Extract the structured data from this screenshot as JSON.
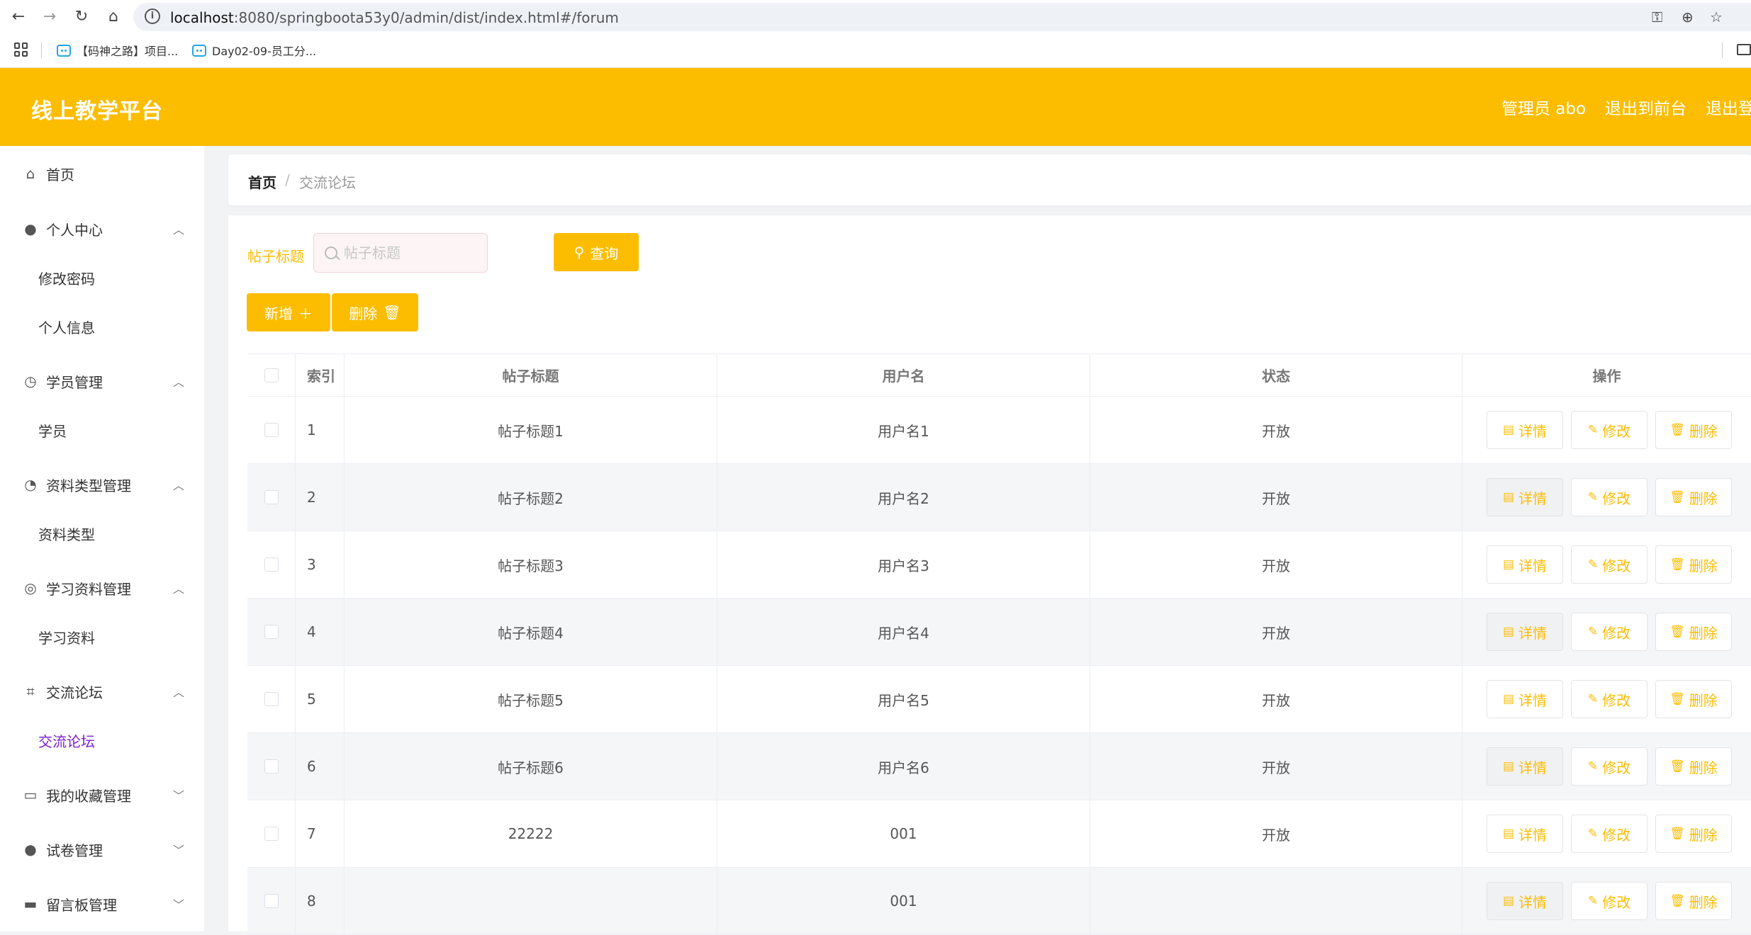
{
  "browser": {
    "url_host": "localhost",
    "url_rest": ":8080/springboota53y0/admin/dist/index.html#/forum",
    "bookmarks": [
      "【码神之路】项目...",
      "Day02-09-员工分..."
    ]
  },
  "header": {
    "title": "线上教学平台",
    "user": "管理员 abo",
    "to_front": "退出到前台",
    "logout": "退出登"
  },
  "sidebar": {
    "home": "首页",
    "personal": "个人中心",
    "change_password": "修改密码",
    "personal_info": "个人信息",
    "student_mgmt": "学员管理",
    "student": "学员",
    "material_type_mgmt": "资料类型管理",
    "material_type": "资料类型",
    "material_mgmt": "学习资料管理",
    "material": "学习资料",
    "forum_group": "交流论坛",
    "forum": "交流论坛",
    "favorites": "我的收藏管理",
    "exam": "试卷管理",
    "board": "留言板管理"
  },
  "breadcrumb": {
    "home": "首页",
    "sep": "/",
    "current": "交流论坛"
  },
  "search": {
    "label": "帖子标题",
    "placeholder": "帖子标题",
    "button": "查询"
  },
  "actions": {
    "add": "新增",
    "delete": "删除"
  },
  "table": {
    "headers": {
      "index": "索引",
      "title": "帖子标题",
      "username": "用户名",
      "status": "状态",
      "ops": "操作"
    },
    "ops": {
      "detail": "详情",
      "edit": "修改",
      "delete": "删除"
    },
    "rows": [
      {
        "index": "1",
        "title": "帖子标题1",
        "username": "用户名1",
        "status": "开放"
      },
      {
        "index": "2",
        "title": "帖子标题2",
        "username": "用户名2",
        "status": "开放"
      },
      {
        "index": "3",
        "title": "帖子标题3",
        "username": "用户名3",
        "status": "开放"
      },
      {
        "index": "4",
        "title": "帖子标题4",
        "username": "用户名4",
        "status": "开放"
      },
      {
        "index": "5",
        "title": "帖子标题5",
        "username": "用户名5",
        "status": "开放"
      },
      {
        "index": "6",
        "title": "帖子标题6",
        "username": "用户名6",
        "status": "开放"
      },
      {
        "index": "7",
        "title": "22222",
        "username": "001",
        "status": "开放"
      },
      {
        "index": "8",
        "title": "",
        "username": "001",
        "status": ""
      }
    ]
  },
  "colors": {
    "accent": "#fcbd00",
    "active_menu": "#7b1fd0"
  },
  "icons": [
    "back-icon",
    "forward-icon",
    "reload-icon",
    "home-icon",
    "info-icon",
    "key-icon",
    "zoom-icon",
    "star-icon",
    "apps-icon",
    "folder-icon",
    "search-icon",
    "plus-icon",
    "trash-icon",
    "document-icon",
    "edit-icon",
    "chevron-up-icon",
    "chevron-down-icon"
  ]
}
